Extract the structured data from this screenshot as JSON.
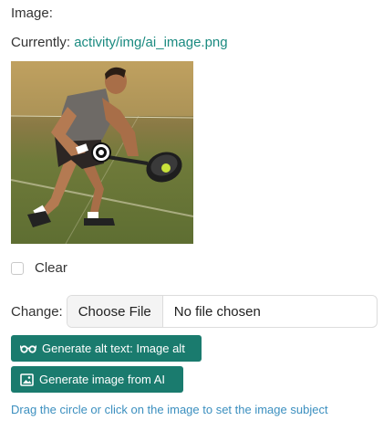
{
  "field": {
    "label": "Image:",
    "current_prefix": "Currently:",
    "current_path": "activity/img/ai_image.png"
  },
  "photo": {
    "alt": "tennis player returning a ball with a frying pan"
  },
  "clear": {
    "label": "Clear",
    "checked": false
  },
  "change": {
    "label": "Change:",
    "button_label": "Choose File",
    "status": "No file chosen"
  },
  "buttons": {
    "alt_text": "Generate alt text: Image alt",
    "generate": "Generate image from AI"
  },
  "hint": "Drag the circle or click on the image to set the image subject",
  "colors": {
    "accent": "#1a7b6e",
    "link": "#1a8a80",
    "hint": "#3b8fbf"
  },
  "icons": {
    "alt_text": "glasses-icon",
    "generate": "image-icon"
  }
}
